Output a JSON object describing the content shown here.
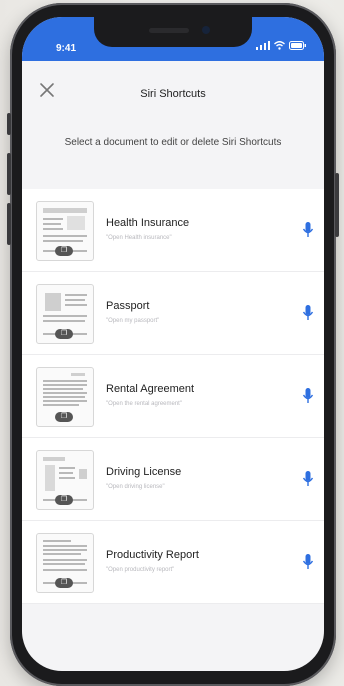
{
  "status_bar": {
    "time": "9:41"
  },
  "header": {
    "title": "Siri Shortcuts"
  },
  "instructions": "Select a document to edit or delete Siri Shortcuts",
  "documents": [
    {
      "title": "Health Insurance",
      "subtitle": "\"Open Health insurance\""
    },
    {
      "title": "Passport",
      "subtitle": "\"Open my passport\""
    },
    {
      "title": "Rental Agreement",
      "subtitle": "\"Open the rental agreement\""
    },
    {
      "title": "Driving License",
      "subtitle": "\"Open driving license\""
    },
    {
      "title": "Productivity Report",
      "subtitle": "\"Open productivity report\""
    }
  ],
  "colors": {
    "accent": "#2e6fe0",
    "mic_icon": "#2e6fe0"
  },
  "icons": {
    "close": "close-icon",
    "microphone": "microphone-icon",
    "page_badge": "page-count-badge"
  }
}
